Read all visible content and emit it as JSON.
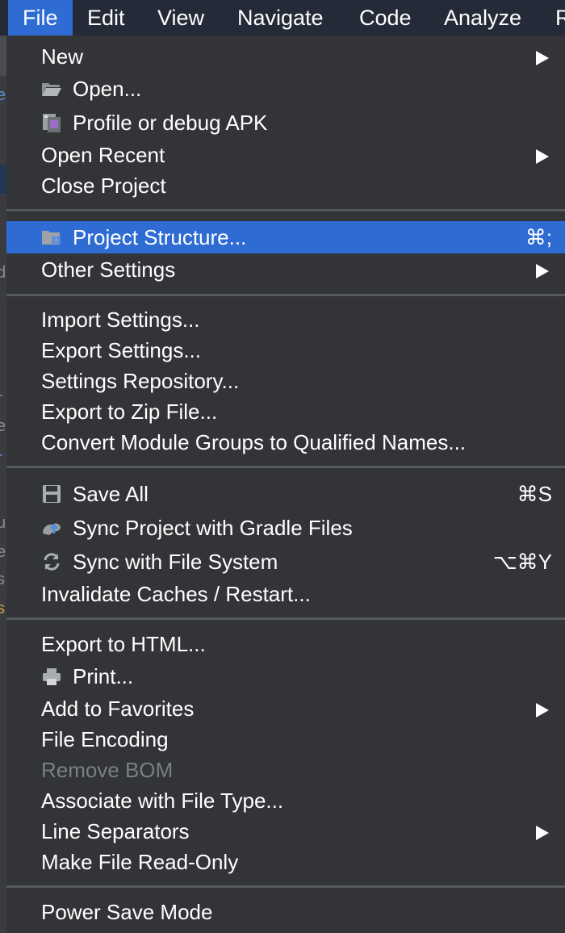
{
  "menubar": {
    "items": [
      "File",
      "Edit",
      "View",
      "Navigate",
      "Code",
      "Analyze",
      "R"
    ]
  },
  "menu": {
    "new": "New",
    "open": "Open...",
    "profile_apk": "Profile or debug APK",
    "open_recent": "Open Recent",
    "close_project": "Close Project",
    "project_structure": "Project Structure...",
    "project_structure_shortcut": "⌘;",
    "other_settings": "Other Settings",
    "import_settings": "Import Settings...",
    "export_settings": "Export Settings...",
    "settings_repository": "Settings Repository...",
    "export_zip": "Export to Zip File...",
    "convert_module_groups": "Convert Module Groups to Qualified Names...",
    "save_all": "Save All",
    "save_all_shortcut": "⌘S",
    "sync_gradle": "Sync Project with Gradle Files",
    "sync_file_system": "Sync with File System",
    "sync_file_system_shortcut": "⌥⌘Y",
    "invalidate_caches": "Invalidate Caches / Restart...",
    "export_html": "Export to HTML...",
    "print": "Print...",
    "add_favorites": "Add to Favorites",
    "file_encoding": "File Encoding",
    "remove_bom": "Remove BOM",
    "associate_file_type": "Associate with File Type...",
    "line_separators": "Line Separators",
    "make_read_only": "Make File Read-Only",
    "power_save_mode": "Power Save Mode"
  },
  "icons": {
    "open": "folder-open-icon",
    "profile_apk": "apk-icon",
    "project_structure": "project-structure-icon",
    "save_all": "save-icon",
    "sync_gradle": "gradle-sync-icon",
    "sync_file_system": "refresh-icon",
    "print": "printer-icon"
  },
  "colors": {
    "menu_background": "#323437",
    "menubar_background": "#252a38",
    "highlight": "#2e6bd3",
    "separator": "#55585c",
    "disabled_text": "#7b7e83"
  }
}
